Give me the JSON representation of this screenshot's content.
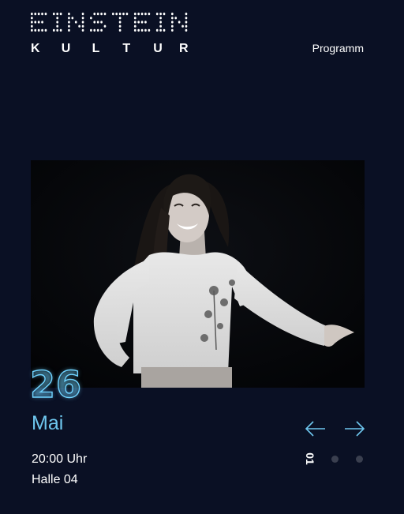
{
  "brand": {
    "logo_top": "EINSTEIN",
    "logo_bottom": "KULTUR"
  },
  "nav": {
    "program_label": "Programm"
  },
  "event": {
    "day": "26",
    "month": "Mai",
    "time": "20:00 Uhr",
    "venue": "Halle 04"
  },
  "slider": {
    "current_page": "01",
    "total_pages": 3,
    "prev_icon": "arrow-left-icon",
    "next_icon": "arrow-right-icon"
  },
  "colors": {
    "background": "#0a1024",
    "accent": "#6ec6ee",
    "text": "#ffffff",
    "inactive_dot": "#3a3f4f"
  }
}
